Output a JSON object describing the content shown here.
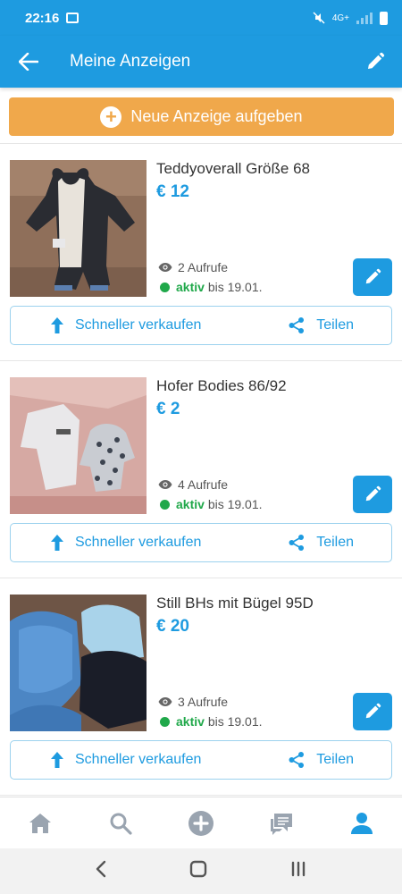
{
  "status_bar": {
    "time": "22:16",
    "network": "4G+"
  },
  "app_bar": {
    "title": "Meine Anzeigen"
  },
  "new_ad_button": {
    "label": "Neue Anzeige aufgeben"
  },
  "listings": [
    {
      "title": "Teddyoverall Größe 68",
      "price": "€ 12",
      "views": "2 Aufrufe",
      "status": "aktiv",
      "until": "bis 19.01.",
      "sell_label": "Schneller verkaufen",
      "share_label": "Teilen"
    },
    {
      "title": "Hofer Bodies 86/92",
      "price": "€ 2",
      "views": "4 Aufrufe",
      "status": "aktiv",
      "until": "bis 19.01.",
      "sell_label": "Schneller verkaufen",
      "share_label": "Teilen"
    },
    {
      "title": "Still BHs mit Bügel 95D",
      "price": "€ 20",
      "views": "3 Aufrufe",
      "status": "aktiv",
      "until": "bis 19.01.",
      "sell_label": "Schneller verkaufen",
      "share_label": "Teilen"
    }
  ],
  "bottom_nav": [
    "home-icon",
    "search-icon",
    "add-circle-icon",
    "messages-icon",
    "profile-icon"
  ],
  "colors": {
    "primary": "#1e9be0",
    "accent": "#f0a84b",
    "active": "#20a84a",
    "nav_active": "#1e9be0",
    "nav_inactive": "#9aa4b0"
  }
}
